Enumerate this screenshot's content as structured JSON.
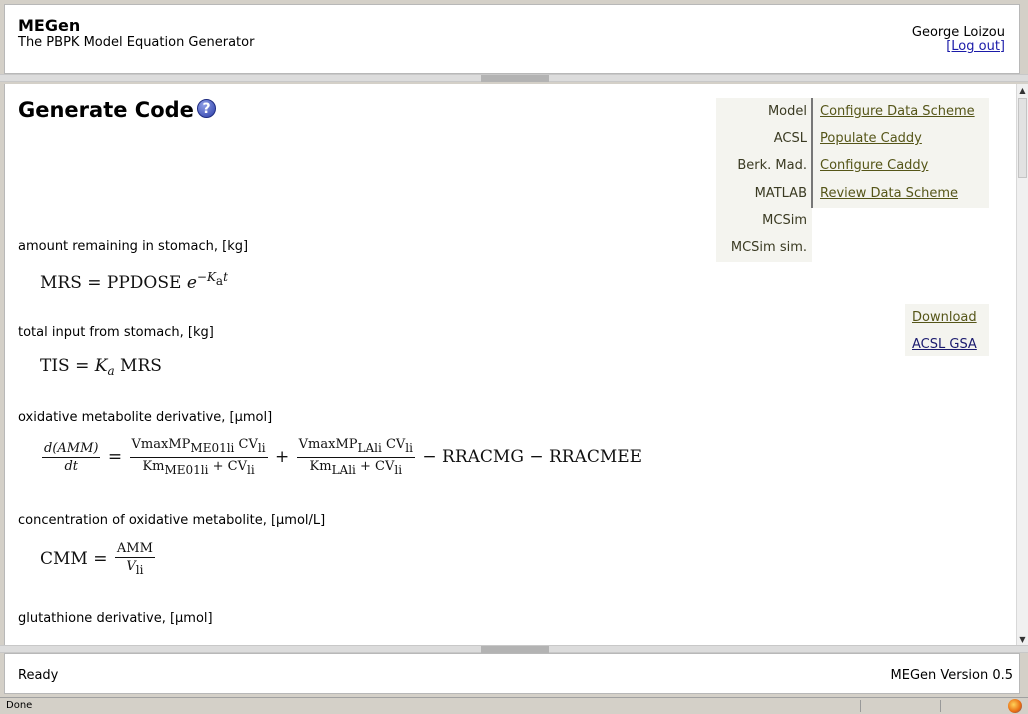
{
  "header": {
    "app_title": "MEGen",
    "app_subtitle": "The PBPK Model Equation Generator",
    "user_name": "George Loizou",
    "logout_label": "[Log out]"
  },
  "main": {
    "page_title": "Generate Code",
    "help_icon": "question-mark-icon",
    "languages": [
      "Model",
      "ACSL",
      "Berk. Mad.",
      "MATLAB",
      "MCSim",
      "MCSim sim."
    ],
    "actions": [
      "Configure Data Scheme",
      "Populate Caddy",
      "Configure Caddy",
      "Review Data Scheme"
    ],
    "downloads": [
      "Download",
      "ACSL GSA"
    ],
    "equations": [
      {
        "desc": "amount remaining in stomach, [kg]",
        "lhs": "MRS",
        "eq": "=",
        "t1": "PPDOSE",
        "e": "e",
        "exp": "−K",
        "exp_sub": "a",
        "exp_t": "t"
      },
      {
        "desc": "total input from stomach, [kg]",
        "lhs": "TIS",
        "eq": "=",
        "k": "K",
        "k_sub": "a",
        "rhs": "MRS"
      },
      {
        "desc": "oxidative metabolite derivative, [µmol]",
        "d_num": "d(AMM)",
        "d_den": "dt",
        "eq": "=",
        "f1_num_a": "VmaxMP",
        "f1_num_sub": "ME01li",
        "f1_num_b": "CV",
        "f1_num_b_sub": "li",
        "f1_den_a": "Km",
        "f1_den_sub": "ME01li",
        "f1_den_b": "+ CV",
        "f1_den_b_sub": "li",
        "plus": "+",
        "f2_num_a": "VmaxMP",
        "f2_num_sub": "LAli",
        "f2_num_b": "CV",
        "f2_num_b_sub": "li",
        "f2_den_a": "Km",
        "f2_den_sub": "LAli",
        "f2_den_b": "+ CV",
        "f2_den_b_sub": "li",
        "tail": "− RRACMG − RRACMEE"
      },
      {
        "desc": "concentration of oxidative metabolite, [µmol/L]",
        "lhs": "CMM",
        "eq": "=",
        "num": "AMM",
        "den": "V",
        "den_sub": "li"
      },
      {
        "desc": "glutathione derivative, [µmol]"
      }
    ]
  },
  "footer": {
    "status": "Ready",
    "version": "MEGen Version 0.5"
  },
  "browser_status": {
    "text": "Done",
    "icon": "firefox-icon"
  }
}
